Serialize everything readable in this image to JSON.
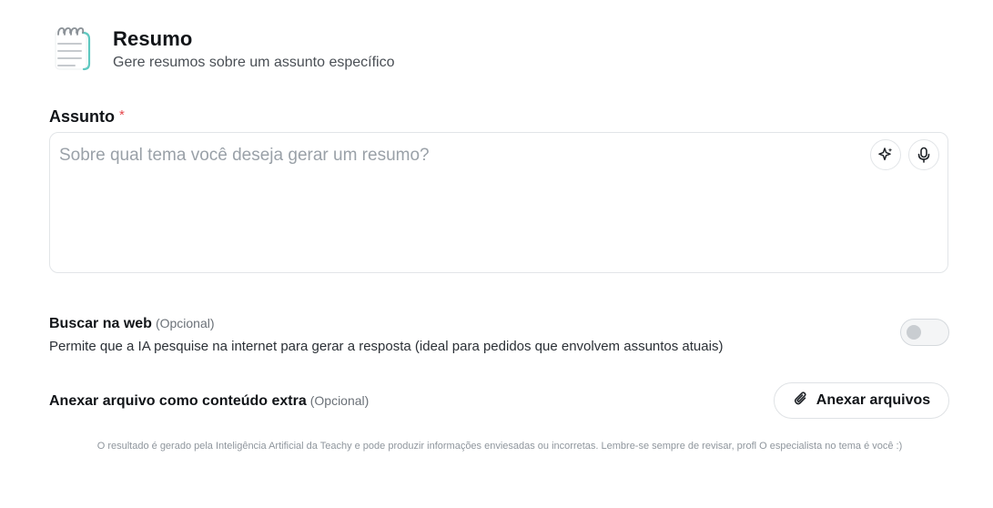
{
  "header": {
    "icon": "notepad-icon",
    "title": "Resumo",
    "subtitle": "Gere resumos sobre um assunto específico"
  },
  "subject": {
    "label": "Assunto",
    "required_mark": "*",
    "value": "",
    "placeholder": "Sobre qual tema você deseja gerar um resumo?",
    "actions": [
      "sparkle-icon",
      "microphone-icon"
    ]
  },
  "web_search": {
    "title": "Buscar na web",
    "optional": "(Opcional)",
    "description": "Permite que a IA pesquise na internet para gerar a resposta (ideal para pedidos que envolvem assuntos atuais)",
    "enabled": false
  },
  "attachment": {
    "title": "Anexar arquivo como conteúdo extra",
    "optional": "(Opcional)",
    "button_label": "Anexar arquivos",
    "button_icon": "paperclip-icon"
  },
  "disclaimer": "O resultado é gerado pela Inteligência Artificial da Teachy e pode produzir informações enviesadas ou incorretas. Lembre-se sempre de revisar, profl O especialista no tema é você :)",
  "colors": {
    "accent": "#5ec8c0",
    "required": "#e5484d",
    "border": "#e2e5e8",
    "placeholder": "#9aa1a8"
  }
}
